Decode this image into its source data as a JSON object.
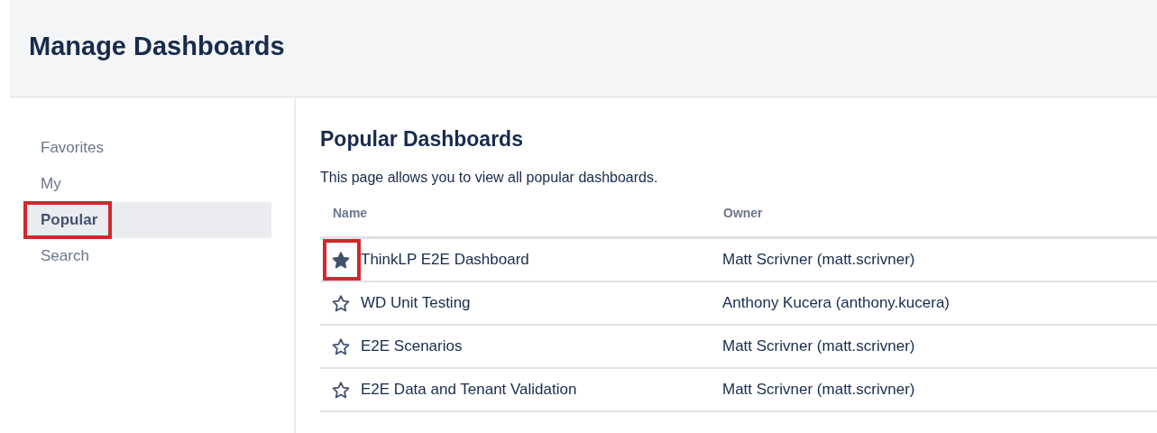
{
  "page_title": "Manage Dashboards",
  "sidebar": {
    "items": [
      {
        "label": "Favorites",
        "selected": false,
        "annotated": false
      },
      {
        "label": "My",
        "selected": false,
        "annotated": false
      },
      {
        "label": "Popular",
        "selected": true,
        "annotated": true
      },
      {
        "label": "Search",
        "selected": false,
        "annotated": false
      }
    ]
  },
  "content": {
    "heading": "Popular Dashboards",
    "description": "This page allows you to view all popular dashboards.",
    "table": {
      "columns": [
        "Name",
        "Owner"
      ],
      "rows": [
        {
          "favorite": true,
          "annotated": true,
          "name": "ThinkLP E2E Dashboard",
          "owner": "Matt Scrivner (matt.scrivner)"
        },
        {
          "favorite": false,
          "annotated": false,
          "name": "WD Unit Testing",
          "owner": "Anthony Kucera (anthony.kucera)"
        },
        {
          "favorite": false,
          "annotated": false,
          "name": "E2E Scenarios",
          "owner": "Matt Scrivner (matt.scrivner)"
        },
        {
          "favorite": false,
          "annotated": false,
          "name": "E2E Data and Tenant Validation",
          "owner": "Matt Scrivner (matt.scrivner)"
        }
      ]
    }
  }
}
